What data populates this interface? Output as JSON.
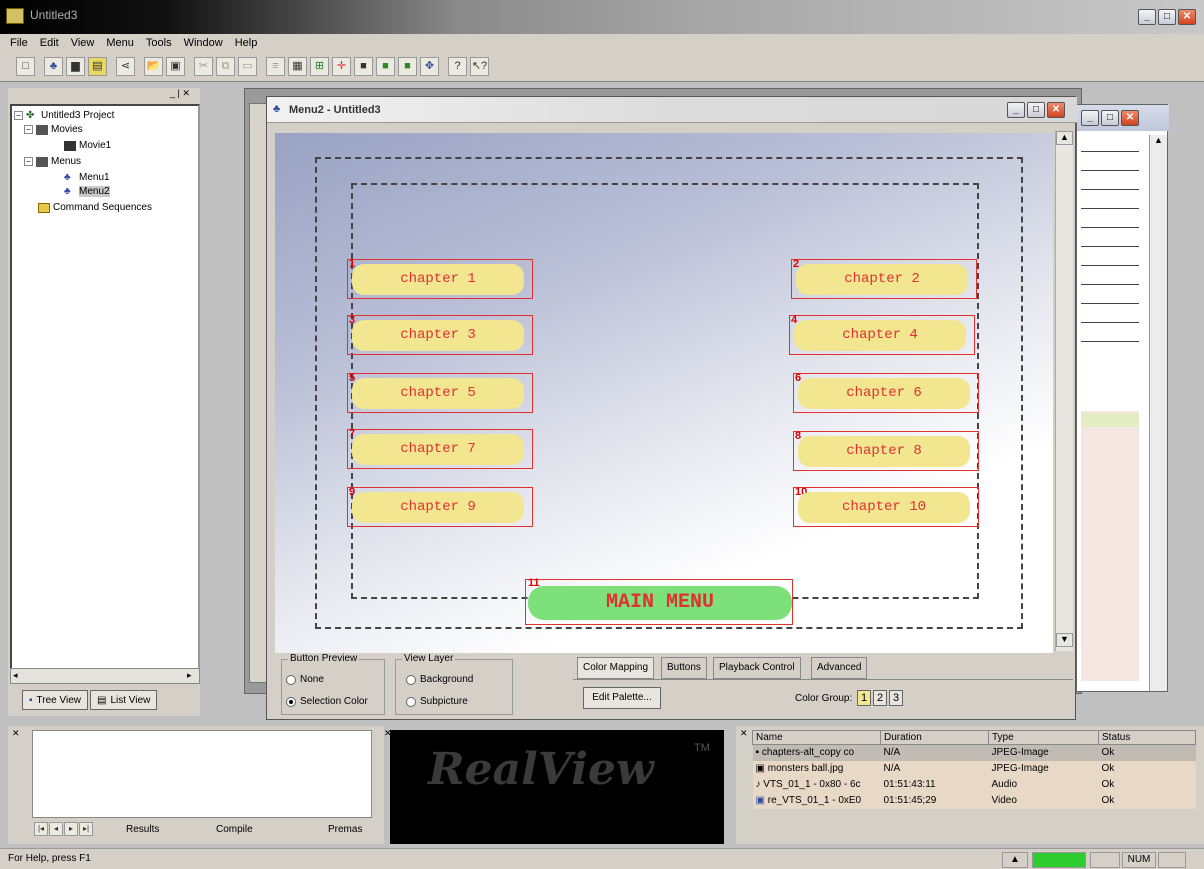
{
  "app": {
    "title": "Untitled3",
    "menubar": [
      "File",
      "Edit",
      "View",
      "Menu",
      "Tools",
      "Window",
      "Help"
    ]
  },
  "toolbar": {
    "icons": [
      "new-icon",
      "project-icon",
      "movie-icon",
      "slideshow-icon",
      "connect-icon",
      "open-icon",
      "save-icon",
      "cut-icon",
      "copy-icon",
      "paste-icon",
      "text-icon",
      "grid-icon",
      "link-icon",
      "jump-icon",
      "preview-icon",
      "play-icon",
      "record-icon",
      "center-icon",
      "help-icon",
      "context-help-icon"
    ]
  },
  "project_tree": {
    "root": "Untitled3 Project",
    "movies_label": "Movies",
    "movie1": "Movie1",
    "menus_label": "Menus",
    "menu1": "Menu1",
    "menu2": "Menu2",
    "command_sequences": "Command Sequences",
    "tab_tree": "Tree View",
    "tab_list": "List View"
  },
  "menu_window": {
    "title": "Menu2 - Untitled3",
    "buttons": [
      {
        "num": "1",
        "label": "chapter 1"
      },
      {
        "num": "2",
        "label": "chapter 2"
      },
      {
        "num": "3",
        "label": "chapter 3"
      },
      {
        "num": "4",
        "label": "chapter 4"
      },
      {
        "num": "5",
        "label": "chapter 5"
      },
      {
        "num": "6",
        "label": "chapter 6"
      },
      {
        "num": "7",
        "label": "chapter 7"
      },
      {
        "num": "8",
        "label": "chapter 8"
      },
      {
        "num": "9",
        "label": "chapter 9"
      },
      {
        "num": "10",
        "label": "chapter 10"
      }
    ],
    "main_menu": {
      "num": "11",
      "label": "MAIN MENU"
    }
  },
  "properties": {
    "button_preview": {
      "label": "Button Preview",
      "opt_none": "None",
      "opt_selection": "Selection Color",
      "selected": "Selection Color"
    },
    "view_layer": {
      "label": "View Layer",
      "opt_background": "Background",
      "opt_subpicture": "Subpicture"
    },
    "tabs": [
      "Color Mapping",
      "Buttons",
      "Playback Control",
      "Advanced"
    ],
    "edit_palette": "Edit Palette...",
    "color_group_label": "Color Group:",
    "color_groups": [
      "1",
      "2",
      "3"
    ],
    "active_color_group": "1"
  },
  "results_panel": {
    "tabs": [
      "Results",
      "Compile",
      "Premas"
    ]
  },
  "realview": {
    "logo": "RealView",
    "tm": "TM"
  },
  "assets": {
    "columns": [
      "Name",
      "Duration",
      "Type",
      "Status"
    ],
    "rows": [
      {
        "icon": "image-icon",
        "name": "chapters-alt_copy co",
        "duration": "N/A",
        "type": "JPEG-Image",
        "status": "Ok"
      },
      {
        "icon": "image-icon",
        "name": "monsters ball.jpg",
        "duration": "N/A",
        "type": "JPEG-Image",
        "status": "Ok"
      },
      {
        "icon": "audio-icon",
        "name": "VTS_01_1 - 0x80 - 6c",
        "duration": "01:51:43:11",
        "type": "Audio",
        "status": "Ok"
      },
      {
        "icon": "video-icon",
        "name": "re_VTS_01_1 - 0xE0",
        "duration": "01:51:45;29",
        "type": "Video",
        "status": "Ok"
      }
    ]
  },
  "status": {
    "help_text": "For Help, press F1",
    "num": "NUM"
  },
  "colors": {
    "accent_red": "#e03030",
    "chapter_fill": "#f2e690",
    "main_menu_fill": "#7de07a"
  }
}
